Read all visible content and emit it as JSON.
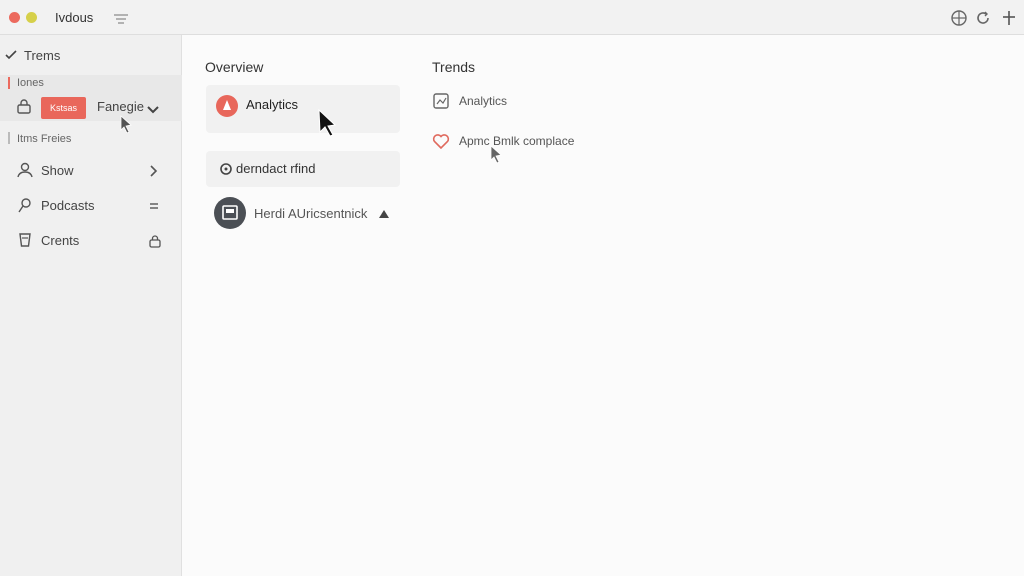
{
  "window": {
    "title": "Ivdous"
  },
  "sidebar": {
    "header": "Trems",
    "group_label": "Iones",
    "badge_text": "Kstsas",
    "dropdown_label": "Fanegie",
    "subgroup_label": "Itms Freies",
    "items": [
      {
        "label": "Show",
        "icon": "person-icon",
        "trailing": "chevron-right-icon"
      },
      {
        "label": "Podcasts",
        "icon": "pin-icon",
        "trailing": "equals-icon"
      },
      {
        "label": "Crents",
        "icon": "cup-icon",
        "trailing": "lock-icon"
      }
    ]
  },
  "overview": {
    "title": "Overview",
    "card_label": "Analytics",
    "row_label": "derndact rfind",
    "user_label": "Herdi AUricsentnick"
  },
  "trends": {
    "title": "Trends",
    "items": [
      {
        "label": "Analytics",
        "icon": "chart-box-icon"
      },
      {
        "label": "Apmc Bmlk complace",
        "icon": "heart-icon"
      }
    ]
  },
  "colors": {
    "accent": "#e9675b",
    "sidebar_bg": "#f0f0f0",
    "main_bg": "#fbfbfb",
    "avatar_bg": "#4b4f55"
  }
}
